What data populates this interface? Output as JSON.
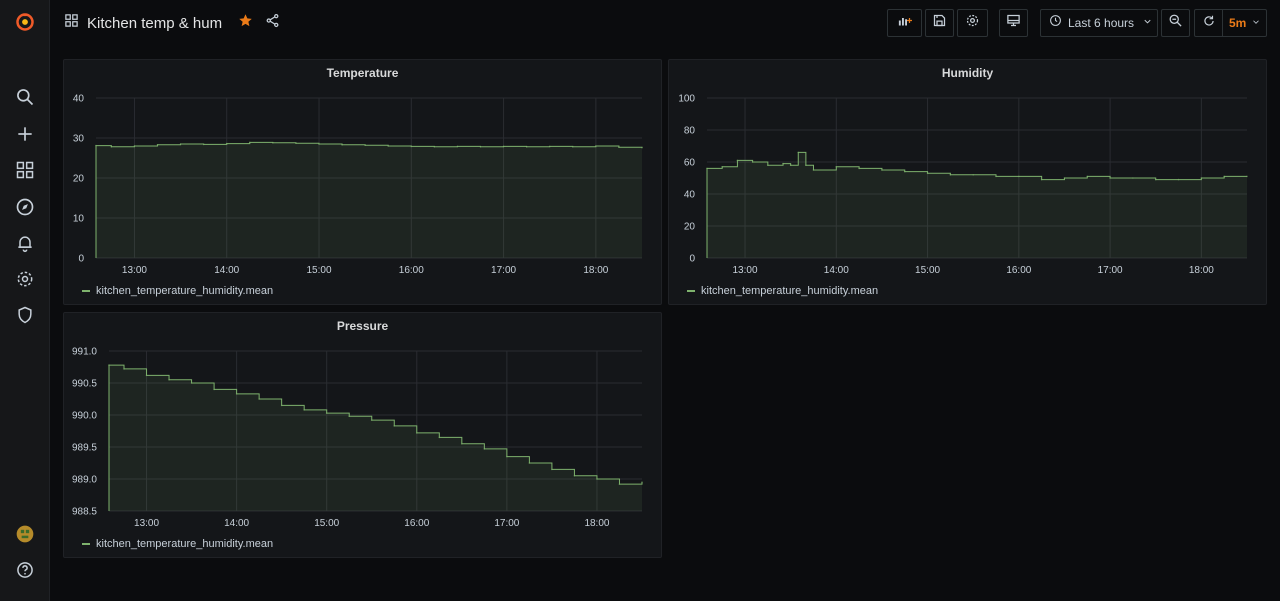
{
  "dashboard": {
    "title": "Kitchen temp & hum",
    "time_range": "Last 6 hours",
    "refresh_interval": "5m",
    "starred": true
  },
  "sidebar": {
    "items": [
      {
        "icon": "grafana-logo-icon"
      },
      {
        "icon": "search-icon"
      },
      {
        "icon": "plus-icon"
      },
      {
        "icon": "dashboards-icon"
      },
      {
        "icon": "explore-compass-icon"
      },
      {
        "icon": "alerting-bell-icon"
      },
      {
        "icon": "configuration-gear-icon"
      },
      {
        "icon": "server-admin-shield-icon"
      },
      {
        "icon": "user-avatar"
      },
      {
        "icon": "help-icon"
      }
    ]
  },
  "colors": {
    "series": "#7eb26d",
    "accent": "#eb7b18",
    "panel_bg": "#141619",
    "page_bg": "#0b0c0e"
  },
  "panels": [
    {
      "title": "Temperature",
      "legend": "kitchen_temperature_humidity.mean",
      "chart_data": {
        "type": "line",
        "title": "Temperature",
        "x_ticks": [
          "13:00",
          "14:00",
          "15:00",
          "16:00",
          "17:00",
          "18:00"
        ],
        "y_ticks": [
          "0",
          "10",
          "20",
          "30",
          "40"
        ],
        "ylim": [
          0,
          40
        ],
        "xlim": [
          "12:35",
          "18:30"
        ],
        "grid": true,
        "series": [
          {
            "name": "kitchen_temperature_humidity.mean",
            "x": [
              "12:35",
              "12:45",
              "13:00",
              "13:15",
              "13:30",
              "13:45",
              "14:00",
              "14:15",
              "14:30",
              "14:45",
              "15:00",
              "15:15",
              "15:30",
              "15:45",
              "16:00",
              "16:15",
              "16:30",
              "16:45",
              "17:00",
              "17:15",
              "17:30",
              "17:45",
              "18:00",
              "18:15",
              "18:30"
            ],
            "values": [
              28.1,
              27.8,
              28.0,
              28.3,
              28.5,
              28.4,
              28.6,
              28.9,
              28.8,
              28.7,
              28.5,
              28.3,
              28.2,
              28.0,
              27.9,
              27.8,
              27.9,
              27.8,
              27.9,
              27.8,
              27.9,
              27.8,
              28.0,
              27.7,
              27.6
            ]
          }
        ]
      }
    },
    {
      "title": "Humidity",
      "legend": "kitchen_temperature_humidity.mean",
      "chart_data": {
        "type": "line",
        "title": "Humidity",
        "x_ticks": [
          "13:00",
          "14:00",
          "15:00",
          "16:00",
          "17:00",
          "18:00"
        ],
        "y_ticks": [
          "0",
          "20",
          "40",
          "60",
          "80",
          "100"
        ],
        "ylim": [
          0,
          100
        ],
        "xlim": [
          "12:35",
          "18:30"
        ],
        "grid": true,
        "series": [
          {
            "name": "kitchen_temperature_humidity.mean",
            "x": [
              "12:35",
              "12:45",
              "12:55",
              "13:05",
              "13:15",
              "13:25",
              "13:30",
              "13:35",
              "13:40",
              "13:45",
              "14:00",
              "14:15",
              "14:30",
              "14:45",
              "15:00",
              "15:15",
              "15:30",
              "15:45",
              "16:00",
              "16:15",
              "16:30",
              "16:45",
              "17:00",
              "17:15",
              "17:30",
              "17:45",
              "18:00",
              "18:15",
              "18:30"
            ],
            "values": [
              56,
              57,
              61,
              60,
              58,
              59,
              58,
              66,
              58,
              55,
              57,
              56,
              55,
              54,
              53,
              52,
              52,
              51,
              51,
              49,
              50,
              51,
              50,
              50,
              49,
              49,
              50,
              51,
              51
            ]
          }
        ]
      }
    },
    {
      "title": "Pressure",
      "legend": "kitchen_temperature_humidity.mean",
      "chart_data": {
        "type": "line",
        "title": "Pressure",
        "x_ticks": [
          "13:00",
          "14:00",
          "15:00",
          "16:00",
          "17:00",
          "18:00"
        ],
        "y_ticks": [
          "988.5",
          "989.0",
          "989.5",
          "990.0",
          "990.5",
          "991.0"
        ],
        "ylim": [
          988.5,
          991.0
        ],
        "xlim": [
          "12:35",
          "18:30"
        ],
        "grid": true,
        "series": [
          {
            "name": "kitchen_temperature_humidity.mean",
            "x": [
              "12:35",
              "12:45",
              "13:00",
              "13:15",
              "13:30",
              "13:45",
              "14:00",
              "14:15",
              "14:30",
              "14:45",
              "15:00",
              "15:15",
              "15:30",
              "15:45",
              "16:00",
              "16:15",
              "16:30",
              "16:45",
              "17:00",
              "17:15",
              "17:30",
              "17:45",
              "18:00",
              "18:15",
              "18:30"
            ],
            "values": [
              990.78,
              990.72,
              990.62,
              990.55,
              990.5,
              990.4,
              990.33,
              990.25,
              990.15,
              990.08,
              990.03,
              989.98,
              989.92,
              989.83,
              989.72,
              989.65,
              989.55,
              989.47,
              989.35,
              989.25,
              989.15,
              989.05,
              989.0,
              988.92,
              988.95
            ]
          }
        ]
      }
    }
  ]
}
